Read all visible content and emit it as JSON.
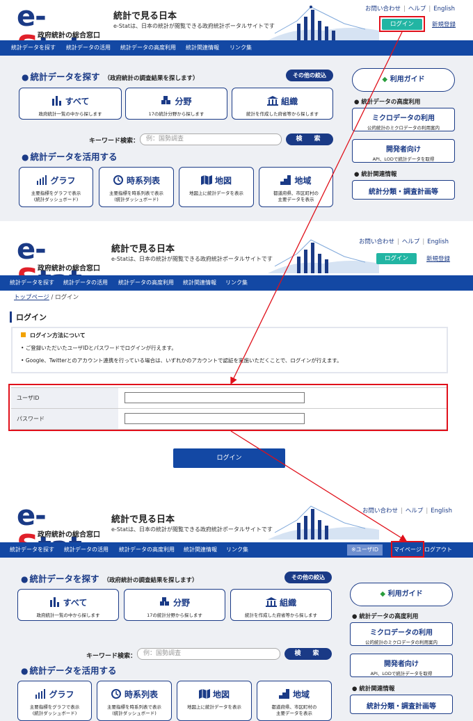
{
  "header": {
    "logo_text_e": "e-",
    "logo_text_s": "S",
    "logo_text_rest": "tat",
    "logo_subtitle": "政府統計の総合窓口",
    "site_title": "統計で見る日本",
    "site_desc": "e-Statは、日本の統計が閲覧できる政府統計ポータルサイトです",
    "links": [
      "お問い合わせ",
      "ヘルプ",
      "English"
    ],
    "login": "ログイン",
    "register": "新規登録"
  },
  "nav": {
    "items": [
      "統計データを探す",
      "統計データの活用",
      "統計データの高度利用",
      "統計関連情報",
      "リンク集"
    ],
    "user_id": "※ユーザID",
    "mypage": "マイページ",
    "logout": "ログアウト"
  },
  "search_section": {
    "title": "統計データを探す",
    "subtitle": "（政府統計の調査結果を探します）",
    "other_filter": "その他の絞込",
    "cards": [
      {
        "title": "すべて",
        "desc": "政府統計一覧の中から探します",
        "icon": "bar-chart-icon"
      },
      {
        "title": "分野",
        "desc": "17の統計分野から探します",
        "icon": "cubes-icon"
      },
      {
        "title": "組織",
        "desc": "統計を作成した府省等から探します",
        "icon": "building-icon"
      }
    ],
    "keyword_label": "キーワード検索：",
    "keyword_placeholder": "例：国勢調査",
    "search_button": "検　索"
  },
  "use_section": {
    "title": "統計データを活用する",
    "cards": [
      {
        "title": "グラフ",
        "desc1": "主要指標をグラフで表示",
        "desc2": "(統計ダッシュボード)",
        "icon": "graph-icon"
      },
      {
        "title": "時系列表",
        "desc1": "主要指標を時系列表で表示",
        "desc2": "(統計ダッシュボード)",
        "icon": "clock-icon"
      },
      {
        "title": "地図",
        "desc1": "地図上に統計データを表示",
        "desc2": "",
        "icon": "map-icon"
      },
      {
        "title": "地域",
        "desc1": "都道府県、市区町村の",
        "desc2": "主要データを表示",
        "icon": "region-icon"
      }
    ]
  },
  "sidebar": {
    "guide": "利用ガイド",
    "adv_heading": "統計データの高度利用",
    "micro_title": "ミクロデータの利用",
    "micro_desc": "公的統計のミクロデータの利用案内",
    "dev_title": "開発者向け",
    "dev_desc": "API、LODで統計データを取得",
    "related_heading": "統計関連情報",
    "classification": "統計分類・調査計画等"
  },
  "login_page": {
    "breadcrumb_top": "トップページ",
    "breadcrumb_sep": "/",
    "breadcrumb_current": "ログイン",
    "heading": "ログイン",
    "info_title": "ログイン方法について",
    "info_lines": [
      "ご登録いただいたユーザIDとパスワードでログインが行えます。",
      "Google、Twitterとのアカウント連携を行っている場合は、いずれかのアカウントで認証を実施いただくことで、ログインが行えます。"
    ],
    "user_id_label": "ユーザID",
    "password_label": "パスワード",
    "login_button": "ログイン"
  },
  "colors": {
    "brand_blue": "#1a3a86",
    "nav_blue": "#1348a4",
    "login_teal": "#22b5a3",
    "highlight_red": "#e0101a"
  }
}
